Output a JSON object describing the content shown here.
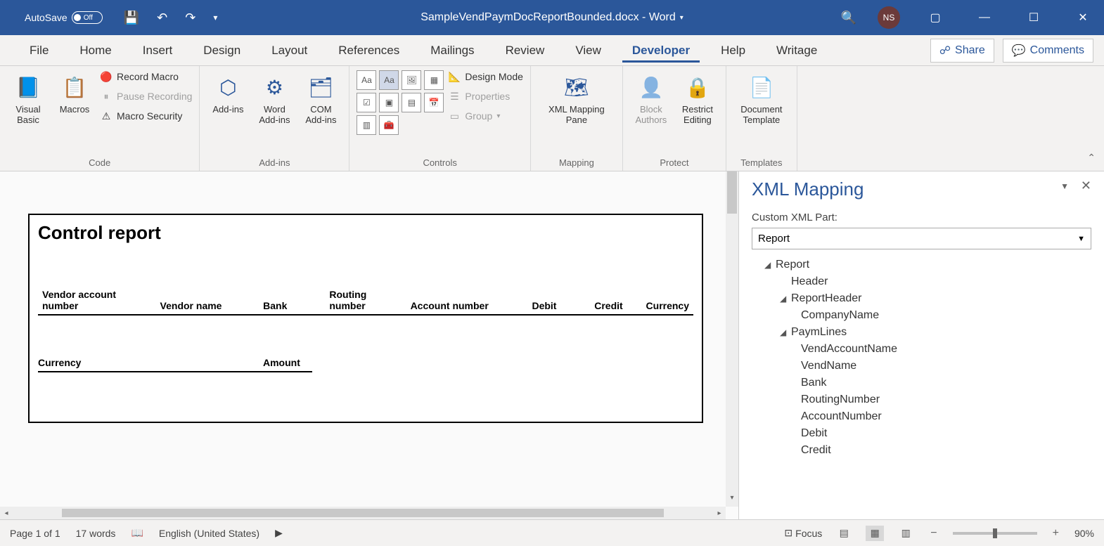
{
  "titlebar": {
    "autosave_label": "AutoSave",
    "autosave_state": "Off",
    "doc_title": "SampleVendPaymDocReportBounded.docx - Word",
    "user_initials": "NS"
  },
  "tabs": {
    "items": [
      "File",
      "Home",
      "Insert",
      "Design",
      "Layout",
      "References",
      "Mailings",
      "Review",
      "View",
      "Developer",
      "Help",
      "Writage"
    ],
    "active": "Developer",
    "share": "Share",
    "comments": "Comments"
  },
  "ribbon": {
    "code": {
      "label": "Code",
      "visual_basic": "Visual Basic",
      "macros": "Macros",
      "record_macro": "Record Macro",
      "pause_recording": "Pause Recording",
      "macro_security": "Macro Security"
    },
    "addins": {
      "label": "Add-ins",
      "addins": "Add-ins",
      "word_addins": "Word Add-ins",
      "com_addins": "COM Add-ins"
    },
    "controls": {
      "label": "Controls",
      "design_mode": "Design Mode",
      "properties": "Properties",
      "group": "Group"
    },
    "mapping": {
      "label": "Mapping",
      "xml_mapping_pane": "XML Mapping Pane"
    },
    "protect": {
      "label": "Protect",
      "block_authors": "Block Authors",
      "restrict_editing": "Restrict Editing"
    },
    "templates": {
      "label": "Templates",
      "document_template": "Document Template"
    }
  },
  "document": {
    "title": "Control report",
    "headers": [
      "Vendor account number",
      "Vendor name",
      "Bank",
      "Routing number",
      "Account number",
      "Debit",
      "Credit",
      "Currency"
    ],
    "sub_headers": [
      "Currency",
      "Amount"
    ]
  },
  "xml_panel": {
    "title": "XML Mapping",
    "subtitle": "Custom XML Part:",
    "selected": "Report",
    "tree": {
      "root": "Report",
      "l1a": "Header",
      "l1b": "ReportHeader",
      "l2a": "CompanyName",
      "l1c": "PaymLines",
      "l2b": "VendAccountName",
      "l2c": "VendName",
      "l2d": "Bank",
      "l2e": "RoutingNumber",
      "l2f": "AccountNumber",
      "l2g": "Debit",
      "l2h": "Credit"
    }
  },
  "statusbar": {
    "page": "Page 1 of 1",
    "words": "17 words",
    "language": "English (United States)",
    "focus": "Focus",
    "zoom": "90%"
  }
}
